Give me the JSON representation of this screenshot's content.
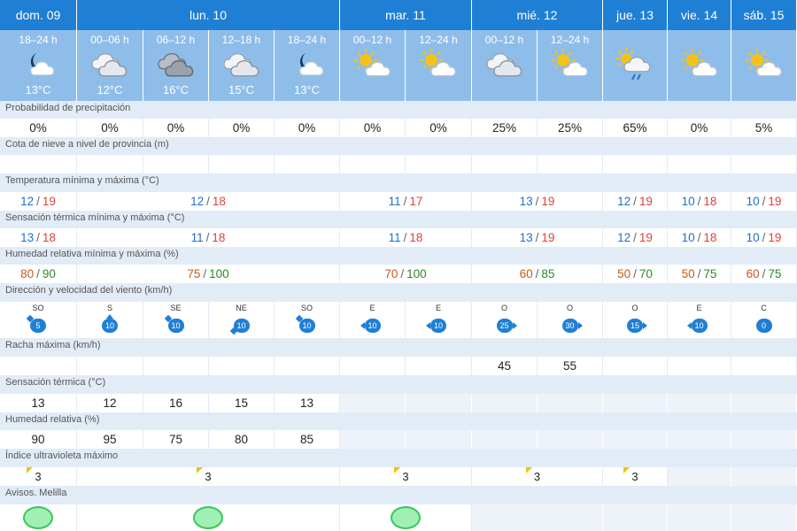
{
  "days": [
    {
      "label": "dom. 09"
    },
    {
      "label": "lun. 10"
    },
    {
      "label": "mar. 11"
    },
    {
      "label": "mié. 12"
    },
    {
      "label": "jue. 13"
    },
    {
      "label": "vie. 14"
    },
    {
      "label": "sáb. 15"
    }
  ],
  "periods": [
    {
      "label": "18–24 h",
      "icon": "moon-cloud-icon",
      "temp": "13°C"
    },
    {
      "label": "00–06 h",
      "icon": "cloud-icon",
      "temp": "12°C"
    },
    {
      "label": "06–12 h",
      "icon": "dark-cloud-icon",
      "temp": "16°C"
    },
    {
      "label": "12–18 h",
      "icon": "cloud-icon",
      "temp": "15°C"
    },
    {
      "label": "18–24 h",
      "icon": "moon-cloud-icon",
      "temp": "13°C"
    },
    {
      "label": "00–12 h",
      "icon": "sun-cloud-icon",
      "temp": ""
    },
    {
      "label": "12–24 h",
      "icon": "sun-cloud-icon",
      "temp": ""
    },
    {
      "label": "00–12 h",
      "icon": "cloud-icon",
      "temp": ""
    },
    {
      "label": "12–24 h",
      "icon": "sun-cloud-icon",
      "temp": ""
    },
    {
      "label": "",
      "icon": "rain-cloud-icon",
      "temp": ""
    },
    {
      "label": "",
      "icon": "sun-cloud-icon",
      "temp": ""
    },
    {
      "label": "",
      "icon": "sun-cloud-icon",
      "temp": ""
    }
  ],
  "labels": {
    "precip": "Probabilidad de precipitación",
    "nieve": "Cota de nieve a nivel de provincia (m)",
    "temp": "Temperatura mínima y máxima (°C)",
    "sens": "Sensación térmica mínima y máxima (°C)",
    "hum": "Humedad relativa mínima y máxima (%)",
    "viento": "Dirección y velocidad del viento (km/h)",
    "racha": "Racha máxima (km/h)",
    "senst": "Sensación térmica (°C)",
    "humr": "Humedad relativa (%)",
    "uv": "Índice ultravioleta máximo",
    "avisos": "Avisos. Melilla"
  },
  "precip": [
    "0%",
    "0%",
    "0%",
    "0%",
    "0%",
    "0%",
    "0%",
    "25%",
    "25%",
    "65%",
    "0%",
    "5%"
  ],
  "temp": [
    {
      "min": "12",
      "max": "19"
    },
    {
      "min": "12",
      "max": "18"
    },
    {
      "min": "11",
      "max": "17"
    },
    {
      "min": "13",
      "max": "19"
    },
    {
      "min": "12",
      "max": "19"
    },
    {
      "min": "10",
      "max": "18"
    },
    {
      "min": "10",
      "max": "19"
    }
  ],
  "sens": [
    {
      "min": "13",
      "max": "18"
    },
    {
      "min": "11",
      "max": "18"
    },
    {
      "min": "11",
      "max": "18"
    },
    {
      "min": "13",
      "max": "19"
    },
    {
      "min": "12",
      "max": "19"
    },
    {
      "min": "10",
      "max": "18"
    },
    {
      "min": "10",
      "max": "19"
    }
  ],
  "hum": [
    {
      "min": "80",
      "max": "90"
    },
    {
      "min": "75",
      "max": "100"
    },
    {
      "min": "70",
      "max": "100"
    },
    {
      "min": "60",
      "max": "85"
    },
    {
      "min": "50",
      "max": "70"
    },
    {
      "min": "50",
      "max": "75"
    },
    {
      "min": "60",
      "max": "75"
    }
  ],
  "wind": [
    {
      "dir": "SO",
      "speed": "5"
    },
    {
      "dir": "S",
      "speed": "10"
    },
    {
      "dir": "SE",
      "speed": "10"
    },
    {
      "dir": "NE",
      "speed": "10"
    },
    {
      "dir": "SO",
      "speed": "10"
    },
    {
      "dir": "E",
      "speed": "10"
    },
    {
      "dir": "E",
      "speed": "10"
    },
    {
      "dir": "O",
      "speed": "25"
    },
    {
      "dir": "O",
      "speed": "30"
    },
    {
      "dir": "O",
      "speed": "15"
    },
    {
      "dir": "E",
      "speed": "10"
    },
    {
      "dir": "C",
      "speed": "0"
    }
  ],
  "racha": [
    "",
    "",
    "",
    "",
    "",
    "",
    "",
    "45",
    "55",
    "",
    "",
    ""
  ],
  "senst": [
    "13",
    "12",
    "16",
    "15",
    "13",
    "",
    "",
    "",
    "",
    "",
    "",
    ""
  ],
  "humr": [
    "90",
    "95",
    "75",
    "80",
    "85",
    "",
    "",
    "",
    "",
    "",
    "",
    ""
  ],
  "uv": [
    "3",
    "3",
    "3",
    "3",
    "3",
    "",
    ""
  ],
  "colors": {
    "header": "#1f7fd4",
    "period": "#8fbde9",
    "label_row": "#e2ecf7",
    "aviso_green": "#37c85c",
    "uv_yellow": "#e9c40f"
  }
}
